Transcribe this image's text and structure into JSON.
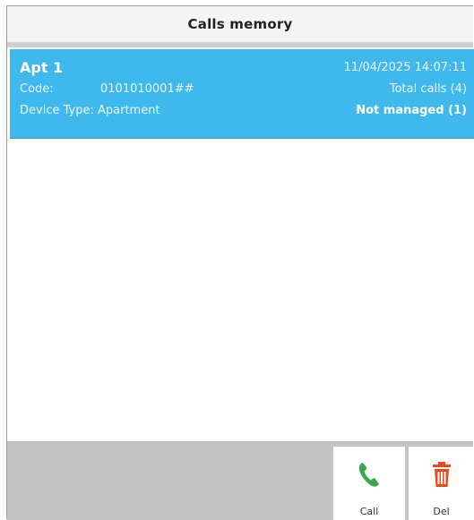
{
  "header": {
    "title": "Calls memory"
  },
  "record": {
    "name": "Apt 1",
    "code_label": "Code:",
    "code_value": "0101010001##",
    "device_type_label": "Device Type:",
    "device_type_value": "Apartment",
    "datetime": "11/04/2025 14:07:11",
    "total_calls": "Total calls (4)",
    "status": "Not managed (1)"
  },
  "actions": {
    "call_label": "Call",
    "del_label": "Del",
    "call_icon": "phone-icon",
    "del_icon": "trash-icon"
  },
  "colors": {
    "selected_row": "#3fb8ee",
    "call_icon": "#3aa84a",
    "del_icon": "#e84a1e",
    "bottom_bar": "#c3c3c3"
  }
}
